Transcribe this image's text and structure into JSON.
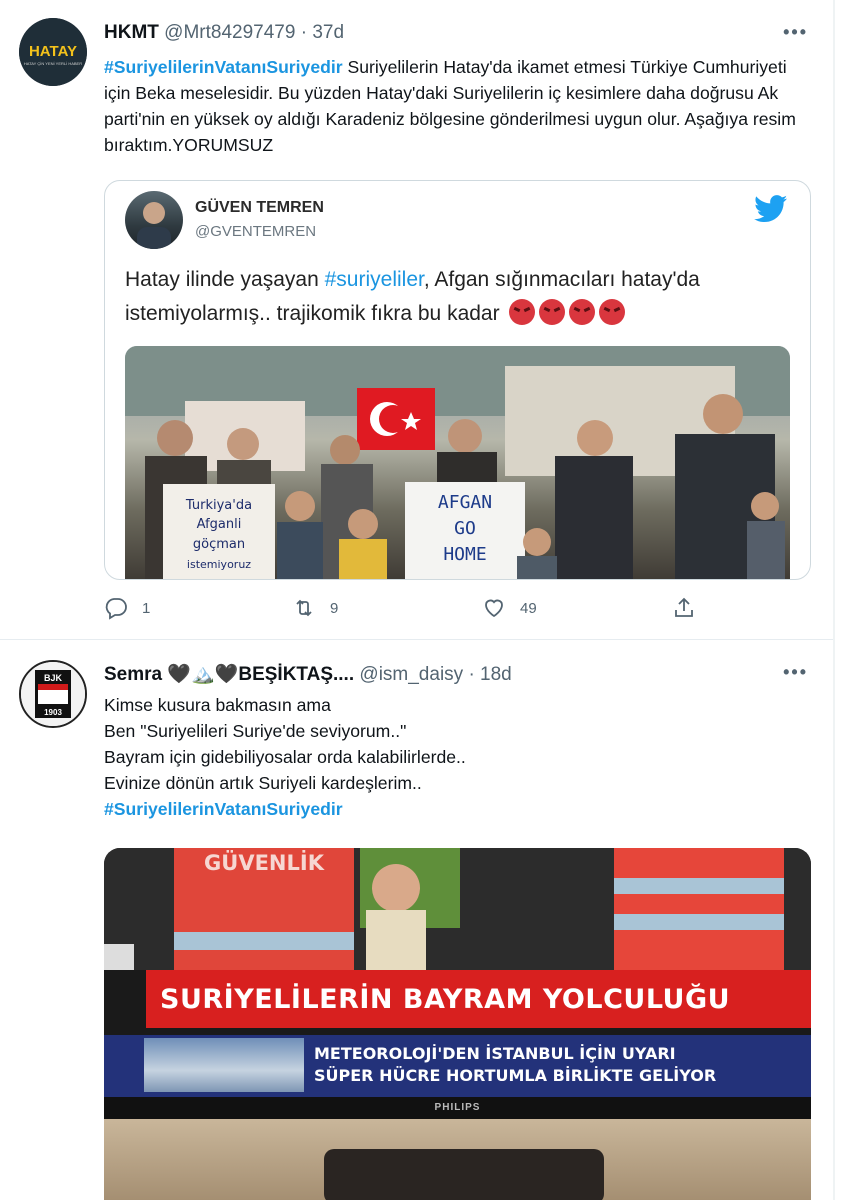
{
  "colors": {
    "hashtag": "#1b95e0",
    "muted": "#536471",
    "border": "#cfd9de"
  },
  "tweets": [
    {
      "name": "HKMT",
      "handle": "@Mrt84297479 · 37d",
      "avatar_text": "HATAY",
      "avatar_subtext": "HATAY ÇİN YENİ YERLİ HABER",
      "more": "•••",
      "hashtag": "#SuriyelilerinVatanıSuriyedir",
      "text": " Suriyelilerin Hatay'da ikamet etmesi Türkiye Cumhuriyeti için Beka meselesidir. Bu yüzden Hatay'daki Suriyelilerin iç kesimlere daha doğrusu Ak parti'nin en yüksek oy aldığı Karadeniz bölgesine gönderilmesi uygun olur. Aşağıya resim bıraktım.YORUMSUZ",
      "quote": {
        "name": "GÜVEN TEMREN",
        "handle": "@GVENTEMREN",
        "text_before": "Hatay ilinde yaşayan ",
        "tag": "#suriyeliler",
        "text_after": ", Afgan sığınmacıları hatay'da istemiyolarmış.. trajikomik fıkra bu kadar",
        "sign_left": "Turkiya'da Afganli göçman istemiyoruz",
        "sign_right": "AFGAN GO HOME",
        "bird_icon": "twitter-bird-icon"
      },
      "stats": {
        "replies": "1",
        "retweets": "9",
        "likes": "49"
      }
    },
    {
      "name": "Semra 🖤🏔️🖤BEŞİKTAŞ....",
      "handle": "@ism_daisy · 18d",
      "avatar_text": "BJK 1903",
      "more": "•••",
      "lines": [
        "Kimse kusura bakmasın ama",
        "Ben \"Suriyelileri Suriye'de seviyorum..\"",
        "Bayram için gidebiliyosalar orda kalabilirlerde..",
        "Evinize dönün artık Suriyeli kardeşlerim.."
      ],
      "hashtag": "#SuriyelilerinVatanıSuriyedir",
      "media": {
        "vest_text": "GÜVENLİK",
        "headline": "SURİYELİLERİN BAYRAM YOLCULUĞU",
        "ticker_line1": "METEOROLOJİ'DEN İSTANBUL İÇİN UYARI",
        "ticker_line2": "SÜPER HÜCRE HORTUMLA BİRLİKTE GELİYOR",
        "brand": "PHILIPS"
      }
    }
  ]
}
